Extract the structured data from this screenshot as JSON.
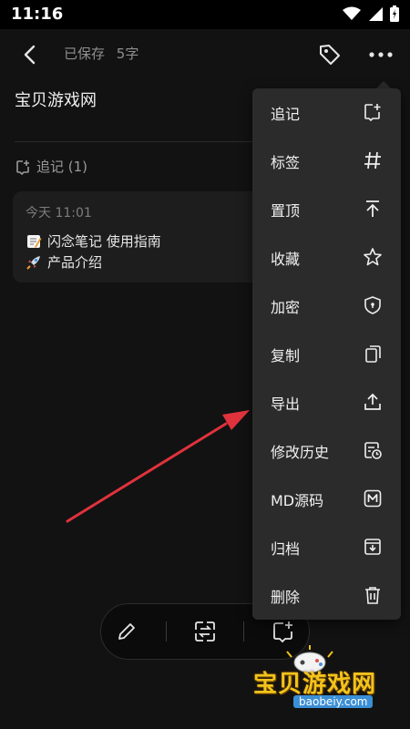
{
  "status_bar": {
    "time": "11:16"
  },
  "header": {
    "saved_label": "已保存",
    "word_count": "5字"
  },
  "note": {
    "title": "宝贝游戏网"
  },
  "trace_section": {
    "label": "追记 (1)",
    "card": {
      "date": "今天 11:01",
      "lines": [
        "闪念笔记 使用指南",
        "产品介绍"
      ]
    }
  },
  "menu": {
    "items": [
      {
        "label": "追记",
        "icon": "add-note-icon"
      },
      {
        "label": "标签",
        "icon": "hash-icon"
      },
      {
        "label": "置顶",
        "icon": "pin-top-icon"
      },
      {
        "label": "收藏",
        "icon": "star-icon"
      },
      {
        "label": "加密",
        "icon": "shield-icon"
      },
      {
        "label": "复制",
        "icon": "copy-icon"
      },
      {
        "label": "导出",
        "icon": "export-icon"
      },
      {
        "label": "修改历史",
        "icon": "history-icon"
      },
      {
        "label": "MD源码",
        "icon": "markdown-icon"
      },
      {
        "label": "归档",
        "icon": "archive-icon"
      },
      {
        "label": "删除",
        "icon": "trash-icon"
      }
    ]
  },
  "watermark": {
    "text": "宝贝游戏网",
    "url": "baobeiy.com"
  },
  "colors": {
    "background": "#121212",
    "menu": "#2b2b2b",
    "arrow": "#e0323c",
    "watermark": "#f2c31c"
  }
}
